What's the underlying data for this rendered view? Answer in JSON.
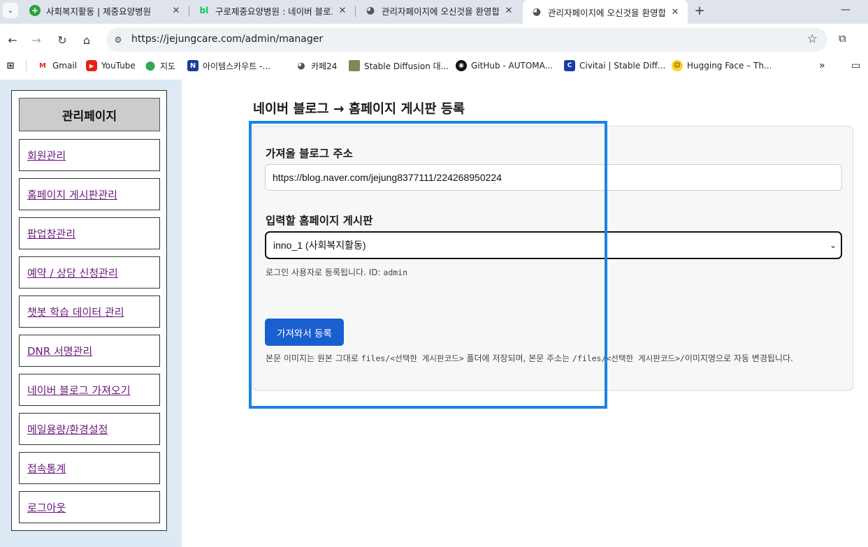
{
  "browser": {
    "tabs": [
      {
        "title": "사회복지활동 | 제중요양병원",
        "icon": "green-plus-icon"
      },
      {
        "title": "구로제중요양병원 : 네이버 블로그",
        "icon": "blog-icon"
      },
      {
        "title": "관리자페이지에 오신것을 환영합니다",
        "icon": "globe-icon"
      },
      {
        "title": "관리자페이지에 오신것을 환영합니다",
        "icon": "globe-icon",
        "active": true
      }
    ],
    "url": "https://jejungcare.com/admin/manager",
    "bookmarks": [
      {
        "label": "Gmail",
        "icon": "gmail-icon"
      },
      {
        "label": "YouTube",
        "icon": "youtube-icon"
      },
      {
        "label": "지도",
        "icon": "maps-icon"
      },
      {
        "label": "아이템스카우트 -...",
        "icon": "itemscout-icon"
      },
      {
        "label": "카페24",
        "icon": "globe-icon"
      },
      {
        "label": "Stable Diffusion 대...",
        "icon": "image-icon"
      },
      {
        "label": "GitHub - AUTOMA...",
        "icon": "github-icon"
      },
      {
        "label": "Civitai | Stable Diff...",
        "icon": "civitai-icon"
      },
      {
        "label": "Hugging Face – Th...",
        "icon": "huggingface-icon"
      }
    ]
  },
  "sidebar": {
    "title": "관리페이지",
    "items": [
      {
        "label": "회원관리"
      },
      {
        "label": "홈페이지 게시판관리"
      },
      {
        "label": "팝업창관리"
      },
      {
        "label": "예약 / 상담 신청관리"
      },
      {
        "label": "챗봇 학습 데이터 관리"
      },
      {
        "label": "DNR 서명관리"
      },
      {
        "label": "네이버 블로그 가져오기"
      },
      {
        "label": "메일용량/환경설정"
      },
      {
        "label": "접속통계"
      },
      {
        "label": "로그아웃"
      }
    ]
  },
  "main": {
    "title": "네이버 블로그 → 홈페이지 게시판 등록",
    "blog_url_label": "가져올 블로그 주소",
    "blog_url_value": "https://blog.naver.com/jejung8377111/224268950224",
    "board_label": "입력할 홈페이지 게시판",
    "board_selected": "inno_1 (사회복지활동)",
    "login_hint_text": "로그인 사용자로 등록됩니다. ID: ",
    "login_hint_id": "admin",
    "submit_label": "가져와서 등록",
    "note": {
      "t1": "본문 이미지는 원본 그대로 ",
      "m1": "files/<선택한 게시판코드>",
      "t2": " 폴더에 저장되며, 본문 주소는 ",
      "m2": "/files/<선택한 게시판코드>/",
      "t3": "이미지명으로 자동 변경됩니다."
    }
  },
  "colors": {
    "highlight": "#1e82e6",
    "primary_button": "#1a5fd0",
    "sidebar_bg": "#dde9f5",
    "visited_link": "#6b1a7a"
  }
}
